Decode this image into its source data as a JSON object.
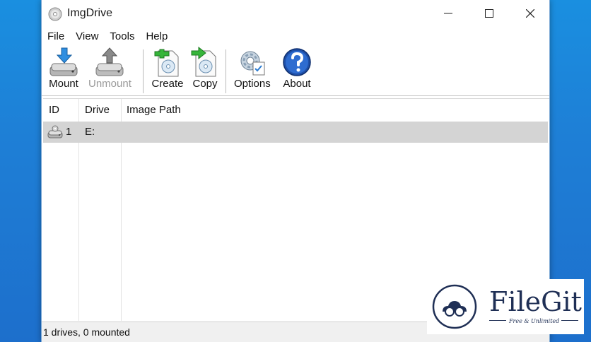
{
  "window": {
    "title": "ImgDrive"
  },
  "menu": [
    "File",
    "View",
    "Tools",
    "Help"
  ],
  "toolbar": {
    "mount": "Mount",
    "unmount": "Unmount",
    "create": "Create",
    "copy": "Copy",
    "options": "Options",
    "about": "About"
  },
  "list": {
    "columns": [
      "ID",
      "Drive",
      "Image Path"
    ],
    "rows": [
      {
        "id": "1",
        "drive": "E:",
        "path": ""
      }
    ]
  },
  "status": {
    "text": "1 drives, 0 mounted"
  },
  "watermark": {
    "brand": "FileGit",
    "tagline": "Free & Unlimited"
  },
  "colors": {
    "desktop": "#1e7fd6",
    "selected_row": "#d4d4d4",
    "brand": "#1f2f55"
  }
}
